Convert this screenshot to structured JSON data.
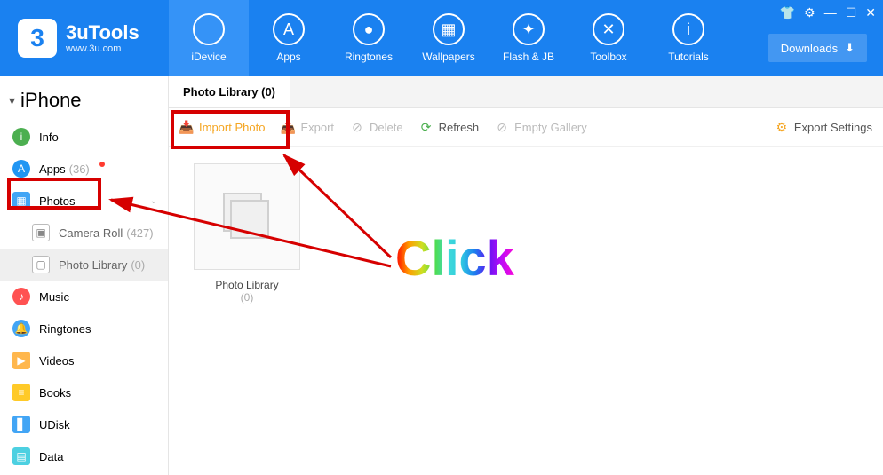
{
  "brand": {
    "title": "3uTools",
    "url": "www.3u.com",
    "logo_char": "3"
  },
  "topnav": [
    {
      "label": "iDevice",
      "glyph": ""
    },
    {
      "label": "Apps",
      "glyph": "A"
    },
    {
      "label": "Ringtones",
      "glyph": "●"
    },
    {
      "label": "Wallpapers",
      "glyph": "▦"
    },
    {
      "label": "Flash & JB",
      "glyph": "✦"
    },
    {
      "label": "Toolbox",
      "glyph": "✕"
    },
    {
      "label": "Tutorials",
      "glyph": "i"
    }
  ],
  "downloads_label": "Downloads",
  "device_name": "iPhone",
  "sidebar": {
    "info": "Info",
    "apps": "Apps",
    "apps_count": "(36)",
    "photos": "Photos",
    "camera_roll": "Camera Roll",
    "camera_roll_count": "(427)",
    "photo_library": "Photo Library",
    "photo_library_count": "(0)",
    "music": "Music",
    "ringtones": "Ringtones",
    "videos": "Videos",
    "books": "Books",
    "udisk": "UDisk",
    "data": "Data"
  },
  "tab_title": "Photo Library (0)",
  "toolbar": {
    "import": "Import Photo",
    "export": "Export",
    "delete": "Delete",
    "refresh": "Refresh",
    "empty": "Empty Gallery",
    "settings": "Export Settings"
  },
  "album": {
    "name": "Photo Library",
    "count": "(0)"
  },
  "annotation_text": "Click"
}
